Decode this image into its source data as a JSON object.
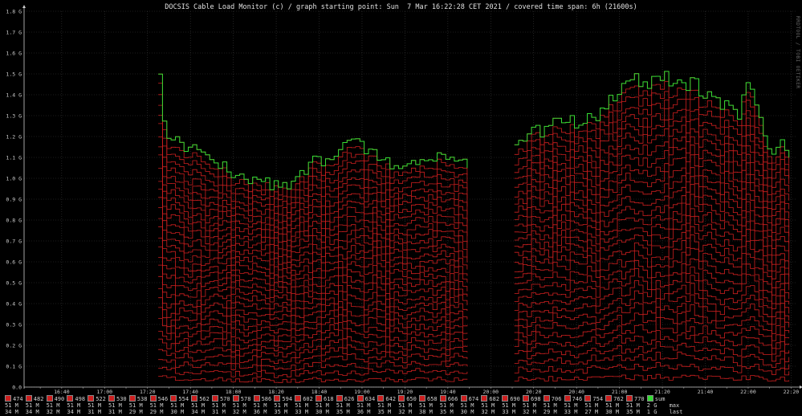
{
  "title": "DOCSIS Cable Load Monitor (c) / graph starting point: Sun  7 Mar 16:22:28 CET 2021 / covered time span: 6h (21600s)",
  "watermark": "RRDTOOL / TOBI OETIKER",
  "colors": {
    "background": "#000000",
    "grid": "#3a3a3a",
    "channel": "#cc1f1f",
    "sum": "#33dd33",
    "axis": "#cccccc"
  },
  "chart_data": {
    "type": "line",
    "ylim": [
      0,
      1.8
    ],
    "yunit": "G",
    "ytick_labels": [
      "0.0",
      "0.1 G",
      "0.2 G",
      "0.3 G",
      "0.4 G",
      "0.5 G",
      "0.6 G",
      "0.7 G",
      "0.8 G",
      "0.9 G",
      "1.0 G",
      "1.1 G",
      "1.2 G",
      "1.3 G",
      "1.4 G",
      "1.5 G",
      "1.6 G",
      "1.7 G",
      "1.8 G"
    ],
    "xtick_labels": [
      "16:40",
      "17:00",
      "17:20",
      "17:40",
      "18:00",
      "18:20",
      "18:40",
      "19:00",
      "19:20",
      "19:40",
      "20:00",
      "20:20",
      "20:40",
      "21:00",
      "21:20",
      "21:40",
      "22:00",
      "22:20"
    ],
    "x_start": "16:22:28",
    "x_end": "22:22:28",
    "gap": [
      "19:50",
      "20:10"
    ],
    "sum_profile": [
      [
        "17:25",
        1.5
      ],
      [
        "17:28",
        1.2
      ],
      [
        "17:35",
        1.17
      ],
      [
        "17:45",
        1.12
      ],
      [
        "17:55",
        1.05
      ],
      [
        "18:05",
        1.0
      ],
      [
        "18:15",
        0.98
      ],
      [
        "18:25",
        0.95
      ],
      [
        "18:35",
        1.07
      ],
      [
        "18:45",
        1.1
      ],
      [
        "18:55",
        1.17
      ],
      [
        "19:05",
        1.12
      ],
      [
        "19:15",
        1.05
      ],
      [
        "19:25",
        1.07
      ],
      [
        "19:35",
        1.12
      ],
      [
        "19:50",
        1.07
      ],
      [
        "20:10",
        1.18
      ],
      [
        "20:20",
        1.22
      ],
      [
        "20:30",
        1.26
      ],
      [
        "20:40",
        1.27
      ],
      [
        "20:50",
        1.32
      ],
      [
        "21:00",
        1.45
      ],
      [
        "21:05",
        1.48
      ],
      [
        "21:10",
        1.46
      ],
      [
        "21:15",
        1.48
      ],
      [
        "21:25",
        1.47
      ],
      [
        "21:35",
        1.45
      ],
      [
        "21:45",
        1.38
      ],
      [
        "21:55",
        1.3
      ],
      [
        "22:00",
        1.48
      ],
      [
        "22:05",
        1.3
      ],
      [
        "22:10",
        1.12
      ],
      [
        "22:15",
        1.2
      ],
      [
        "22:20",
        1.05
      ]
    ],
    "series": [
      {
        "name": "474",
        "max": "51 M",
        "last": "34 M"
      },
      {
        "name": "482",
        "max": "51 M",
        "last": "34 M"
      },
      {
        "name": "490",
        "max": "51 M",
        "last": "32 M"
      },
      {
        "name": "498",
        "max": "51 M",
        "last": "34 M"
      },
      {
        "name": "522",
        "max": "51 M",
        "last": "31 M"
      },
      {
        "name": "530",
        "max": "51 M",
        "last": "31 M"
      },
      {
        "name": "538",
        "max": "51 M",
        "last": "29 M"
      },
      {
        "name": "546",
        "max": "51 M",
        "last": "29 M"
      },
      {
        "name": "554",
        "max": "51 M",
        "last": "30 M"
      },
      {
        "name": "562",
        "max": "51 M",
        "last": "34 M"
      },
      {
        "name": "570",
        "max": "51 M",
        "last": "31 M"
      },
      {
        "name": "578",
        "max": "51 M",
        "last": "32 M"
      },
      {
        "name": "586",
        "max": "51 M",
        "last": "36 M"
      },
      {
        "name": "594",
        "max": "51 M",
        "last": "35 M"
      },
      {
        "name": "602",
        "max": "51 M",
        "last": "33 M"
      },
      {
        "name": "618",
        "max": "51 M",
        "last": "30 M"
      },
      {
        "name": "626",
        "max": "51 M",
        "last": "35 M"
      },
      {
        "name": "634",
        "max": "51 M",
        "last": "36 M"
      },
      {
        "name": "642",
        "max": "51 M",
        "last": "35 M"
      },
      {
        "name": "650",
        "max": "51 M",
        "last": "32 M"
      },
      {
        "name": "658",
        "max": "51 M",
        "last": "38 M"
      },
      {
        "name": "666",
        "max": "51 M",
        "last": "35 M"
      },
      {
        "name": "674",
        "max": "51 M",
        "last": "30 M"
      },
      {
        "name": "682",
        "max": "51 M",
        "last": "32 M"
      },
      {
        "name": "690",
        "max": "51 M",
        "last": "33 M"
      },
      {
        "name": "698",
        "max": "51 M",
        "last": "32 M"
      },
      {
        "name": "706",
        "max": "51 M",
        "last": "29 M"
      },
      {
        "name": "746",
        "max": "51 M",
        "last": "33 M"
      },
      {
        "name": "754",
        "max": "51 M",
        "last": "27 M"
      },
      {
        "name": "762",
        "max": "51 M",
        "last": "30 M"
      },
      {
        "name": "770",
        "max": "51 M",
        "last": "35 M"
      },
      {
        "name": "sum",
        "max": "2 G",
        "last": "1 G"
      }
    ],
    "row_labels": {
      "max": "max",
      "last": "last"
    }
  }
}
